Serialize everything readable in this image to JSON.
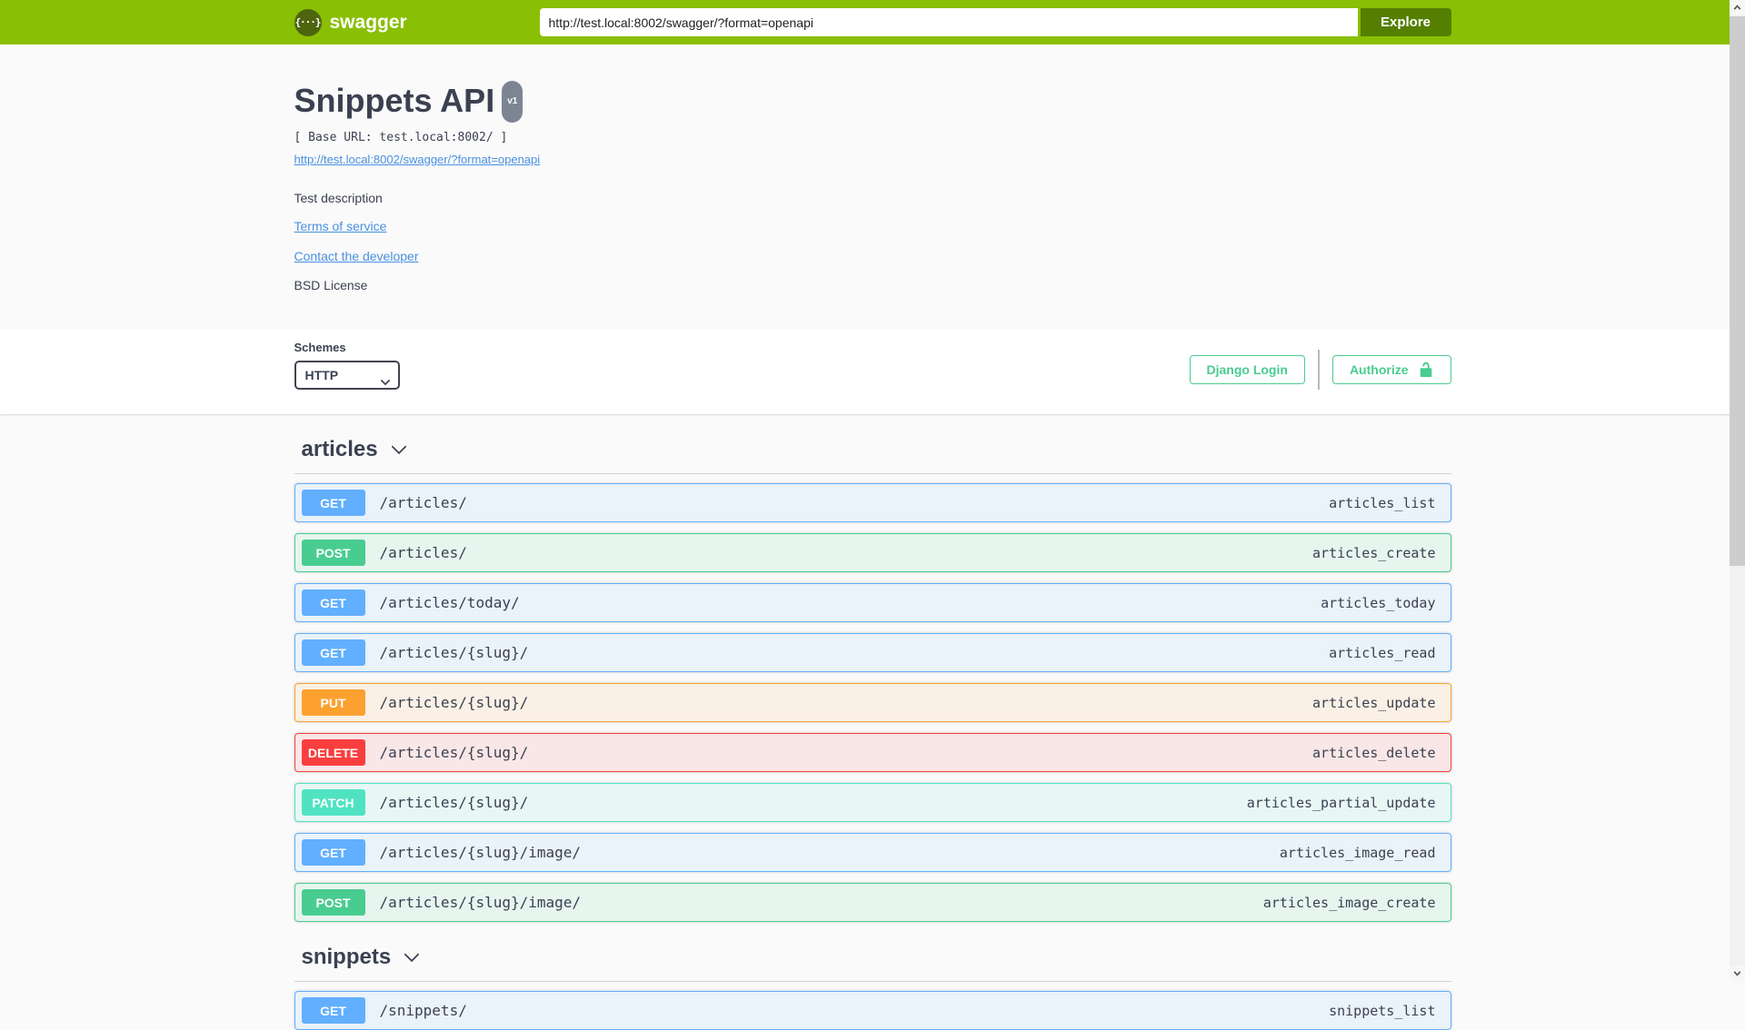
{
  "topbar": {
    "logo_label": "swagger",
    "logo_glyph": "{···}",
    "url_input_value": "http://test.local:8002/swagger/?format=openapi",
    "explore_button_label": "Explore",
    "background_color": "#89bf04",
    "explore_button_color": "#547f00"
  },
  "info": {
    "title": "Snippets API",
    "version_badge": "v1",
    "base_url_text": "[ Base URL: test.local:8002/ ]",
    "spec_link_text": "http://test.local:8002/swagger/?format=openapi",
    "description": "Test description",
    "terms_of_service_label": "Terms of service",
    "contact_label": "Contact the developer",
    "license_label": "BSD License",
    "link_color": "#4990e2",
    "heading_color": "#3b4151"
  },
  "scheme_section": {
    "schemes_label": "Schemes",
    "selected_scheme": "HTTP",
    "django_login_label": "Django Login",
    "authorize_label": "Authorize",
    "accent_color": "#49cc90"
  },
  "icons": {
    "logo": "curly-braces-icon",
    "authorize_button": "unlock-icon",
    "section_header": "chevron-down-icon",
    "scheme_select": "chevron-down-icon",
    "scrollbar_top": "scroll-up-icon",
    "scrollbar_bottom": "scroll-down-icon"
  },
  "method_colors": {
    "GET": {
      "badge": "#61affe",
      "border": "#61affe",
      "background": "rgba(97,175,254,0.1)"
    },
    "POST": {
      "badge": "#49cc90",
      "border": "#49cc90",
      "background": "rgba(73,204,144,0.1)"
    },
    "PUT": {
      "badge": "#fca130",
      "border": "#fca130",
      "background": "rgba(252,161,48,0.1)"
    },
    "DELETE": {
      "badge": "#f93e3e",
      "border": "#f93e3e",
      "background": "rgba(249,62,62,0.1)"
    },
    "PATCH": {
      "badge": "#50e3c2",
      "border": "#50e3c2",
      "background": "rgba(80,227,194,0.1)"
    }
  },
  "sections": [
    {
      "name": "articles",
      "operations": [
        {
          "method": "GET",
          "path": "/articles/",
          "operation_id": "articles_list"
        },
        {
          "method": "POST",
          "path": "/articles/",
          "operation_id": "articles_create"
        },
        {
          "method": "GET",
          "path": "/articles/today/",
          "operation_id": "articles_today"
        },
        {
          "method": "GET",
          "path": "/articles/{slug}/",
          "operation_id": "articles_read"
        },
        {
          "method": "PUT",
          "path": "/articles/{slug}/",
          "operation_id": "articles_update"
        },
        {
          "method": "DELETE",
          "path": "/articles/{slug}/",
          "operation_id": "articles_delete"
        },
        {
          "method": "PATCH",
          "path": "/articles/{slug}/",
          "operation_id": "articles_partial_update"
        },
        {
          "method": "GET",
          "path": "/articles/{slug}/image/",
          "operation_id": "articles_image_read"
        },
        {
          "method": "POST",
          "path": "/articles/{slug}/image/",
          "operation_id": "articles_image_create"
        }
      ]
    },
    {
      "name": "snippets",
      "operations": [
        {
          "method": "GET",
          "path": "/snippets/",
          "operation_id": "snippets_list"
        }
      ]
    }
  ]
}
